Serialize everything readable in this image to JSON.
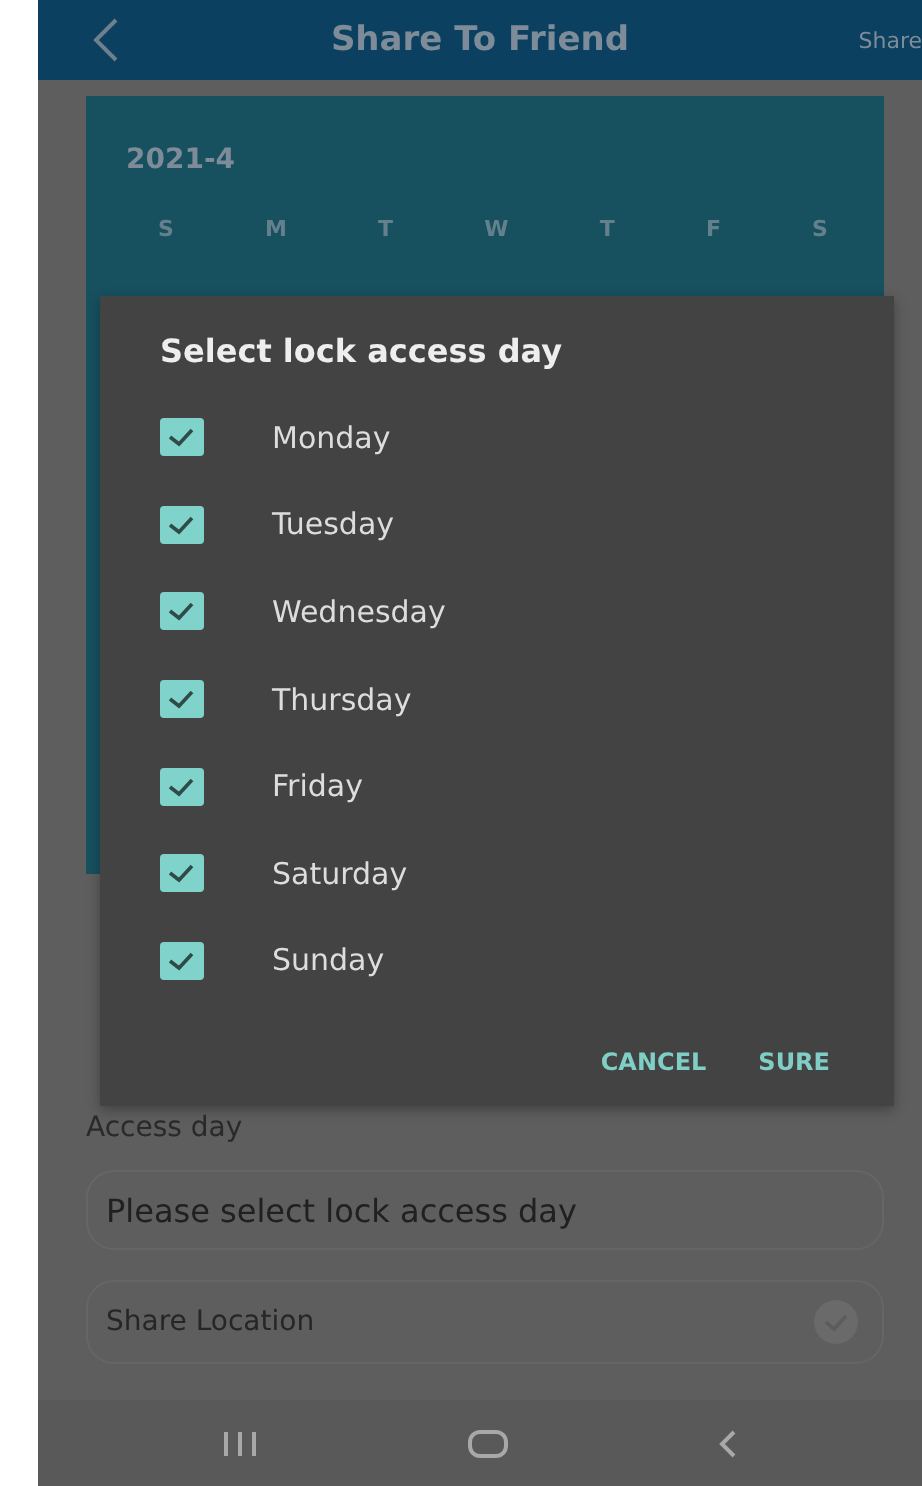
{
  "header": {
    "title": "Share To Friend",
    "action": "Share"
  },
  "calendar": {
    "month": "2021-4",
    "weekdays": [
      "S",
      "M",
      "T",
      "W",
      "T",
      "F",
      "S"
    ]
  },
  "dialog": {
    "title": "Select lock access day",
    "options": [
      {
        "label": "Monday",
        "checked": true
      },
      {
        "label": "Tuesday",
        "checked": true
      },
      {
        "label": "Wednesday",
        "checked": true
      },
      {
        "label": "Thursday",
        "checked": true
      },
      {
        "label": "Friday",
        "checked": true
      },
      {
        "label": "Saturday",
        "checked": true
      },
      {
        "label": "Sunday",
        "checked": true
      }
    ],
    "buttons": [
      "CANCEL",
      "SURE"
    ]
  },
  "form": {
    "access_day_label": "Access day",
    "access_day_field": {
      "placeholder": "Please select lock access day"
    },
    "share_location": {
      "label": "Share Location",
      "checked": false
    }
  }
}
